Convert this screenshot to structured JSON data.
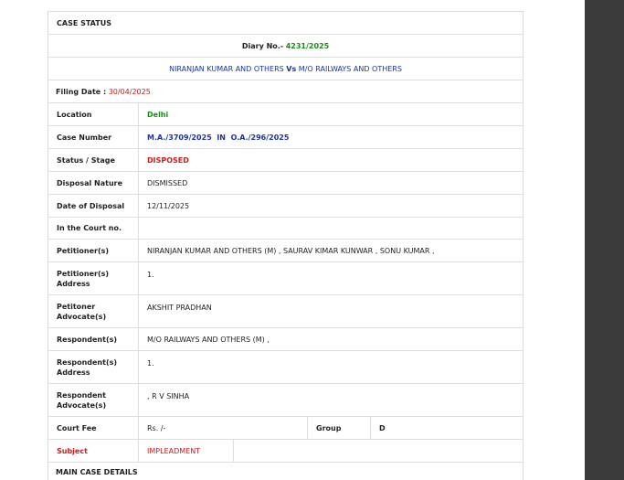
{
  "case_status": {
    "header": "CASE STATUS",
    "diary_label": "Diary No.-",
    "diary_no": "4231/2025",
    "parties": "NIRANJAN KUMAR AND OTHERS",
    "vs": "Vs",
    "respondent_party": "M/O RAILWAYS AND OTHERS",
    "filing_label": "Filing Date :",
    "filing_date": "30/04/2025",
    "rows": {
      "location": {
        "label": "Location",
        "value": "Delhi"
      },
      "case_number": {
        "label": "Case Number",
        "value": "M.A./3709/2025  IN  O.A./296/2025"
      },
      "status": {
        "label": "Status / Stage",
        "value": "DISPOSED"
      },
      "disposal_nature": {
        "label": "Disposal Nature",
        "value": "DISMISSED"
      },
      "date_of_disposal": {
        "label": "Date of Disposal",
        "value": "12/11/2025"
      },
      "court_no": {
        "label": "In the Court no.",
        "value": ""
      },
      "petitioners": {
        "label": "Petitioner(s)",
        "value": "NIRANJAN KUMAR AND OTHERS (M) , SAURAV KIMAR KUNWAR , SONU KUMAR ,"
      },
      "petitioner_address": {
        "label": "Petitioner(s) Address",
        "value": "1."
      },
      "petitioner_advocate": {
        "label": "Petitoner Advocate(s)",
        "value": "AKSHIT PRADHAN"
      },
      "respondents": {
        "label": "Respondent(s)",
        "value": "M/O RAILWAYS AND OTHERS (M) ,"
      },
      "respondent_address": {
        "label": "Respondent(s) Address",
        "value": "1."
      },
      "respondent_advocate": {
        "label": "Respondent Advocate(s)",
        "value": ", R V SINHA"
      },
      "court_fee": {
        "label": "Court Fee",
        "value": "Rs. /-",
        "group_label": "Group",
        "group_value": "D"
      },
      "subject": {
        "label": "Subject",
        "value": "IMPLEADMENT"
      }
    },
    "main_case_header": "MAIN CASE DETAILS"
  }
}
